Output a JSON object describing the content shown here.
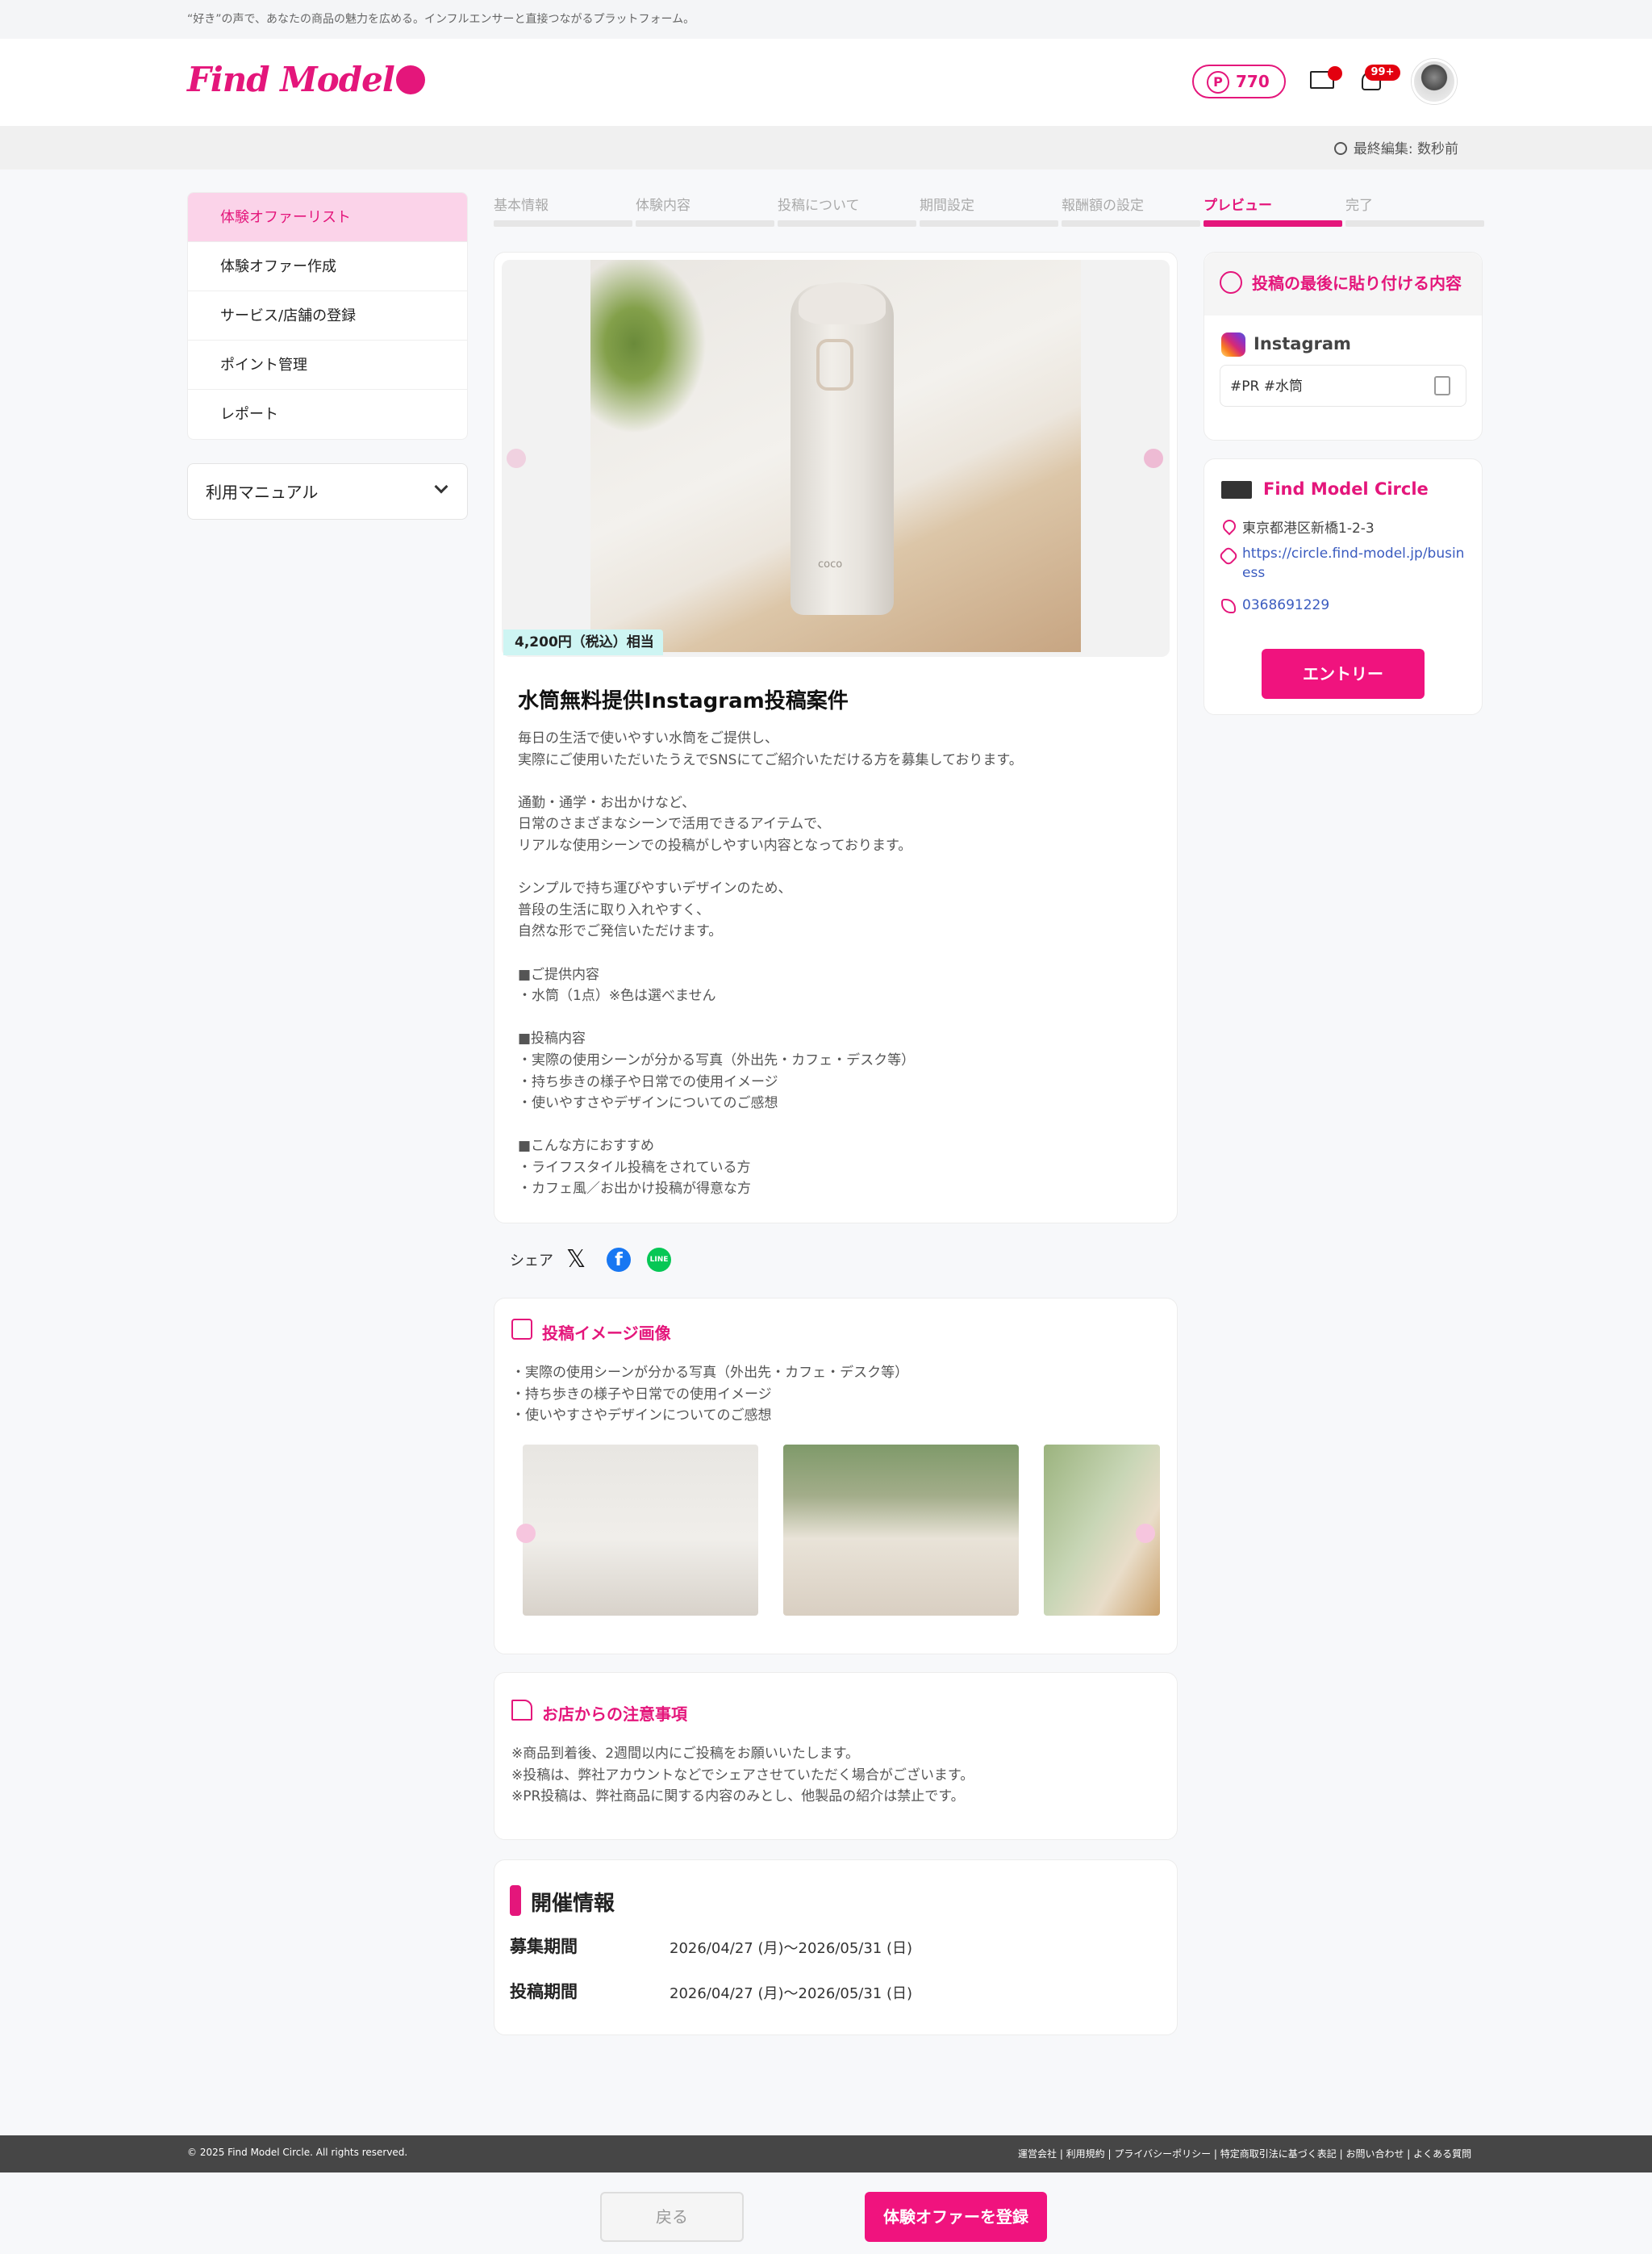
{
  "topbar": {
    "tagline": "“好き”の声で、あなたの商品の魅力を広める。インフルエンサーと直接つながるプラットフォーム。"
  },
  "header": {
    "logo": "Find Model",
    "points": "770",
    "points_icon_label": "P",
    "notifications_badge": "99+"
  },
  "editbar": {
    "last_edited": "最終編集: 数秒前"
  },
  "sidebar": {
    "items": [
      {
        "label": "体験オファーリスト",
        "active": true
      },
      {
        "label": "体験オファー作成"
      },
      {
        "label": "サービス/店舗の登録"
      },
      {
        "label": "ポイント管理"
      },
      {
        "label": "レポート"
      }
    ],
    "manual": "利用マニュアル"
  },
  "steps": [
    {
      "label": "基本情報"
    },
    {
      "label": "体験内容"
    },
    {
      "label": "投稿について"
    },
    {
      "label": "期間設定"
    },
    {
      "label": "報酬額の設定"
    },
    {
      "label": "プレビュー",
      "active": true
    },
    {
      "label": "完了"
    }
  ],
  "offer": {
    "price_tag": "4,200円（税込）相当",
    "title": "水筒無料提供Instagram投稿案件",
    "description": "毎日の生活で使いやすい水筒をご提供し、\n実際にご使用いただいたうえでSNSにてご紹介いただける方を募集しております。\n\n通勤・通学・お出かけなど、\n日常のさまざまなシーンで活用できるアイテムで、\nリアルな使用シーンでの投稿がしやすい内容となっております。\n\nシンプルで持ち運びやすいデザインのため、\n普段の生活に取り入れやすく、\n自然な形でご発信いただけます。\n\n■ご提供内容\n・水筒（1点）※色は選べません\n\n■投稿内容\n・実際の使用シーンが分かる写真（外出先・カフェ・デスク等）\n・持ち歩きの様子や日常での使用イメージ\n・使いやすさやデザインについてのご感想\n\n■こんな方におすすめ\n・ライフスタイル投稿をされている方\n・カフェ風／お出かけ投稿が得意な方",
    "product_logo_text": "coco"
  },
  "share": {
    "label": "シェア",
    "line_label": "LINE"
  },
  "post_images": {
    "heading": "投稿イメージ画像",
    "text": "・実際の使用シーンが分かる写真（外出先・カフェ・デスク等）\n・持ち歩きの様子や日常での使用イメージ\n・使いやすさやデザインについてのご感想"
  },
  "notes": {
    "heading": "お店からの注意事項",
    "text": "※商品到着後、2週間以内にご投稿をお願いいたします。\n※投稿は、弊社アカウントなどでシェアさせていただく場合がございます。\n※PR投稿は、弊社商品に関する内容のみとし、他製品の紹介は禁止です。"
  },
  "event": {
    "heading": "開催情報",
    "recruit_label": "募集期間",
    "recruit_value": "2026/04/27 (月)〜2026/05/31 (日)",
    "post_label": "投稿期間",
    "post_value": "2026/04/27 (月)〜2026/05/31 (日)"
  },
  "side": {
    "paste_heading": "投稿の最後に貼り付ける内容",
    "platform": "Instagram",
    "hashtags": "#PR #水筒",
    "store_name": "Find Model Circle",
    "address": "東京都港区新橋1-2-3",
    "url_line1": "https://circle.find-model.jp/busin",
    "url_line2": "ess",
    "phone": "0368691229",
    "entry_button": "エントリー"
  },
  "footer": {
    "copyright": "© 2025 Find Model Circle. All rights reserved.",
    "links": "運営会社 | 利用規約 | プライバシーポリシー | 特定商取引法に基づく表記 | お問い合わせ | よくある質問"
  },
  "actions": {
    "back": "戻る",
    "register": "体験オファーを登録"
  },
  "colors": {
    "accent": "#e4167b",
    "accent_light": "#fbd3e9",
    "price_bg": "#cef5f3",
    "footer_bg": "#464646"
  }
}
